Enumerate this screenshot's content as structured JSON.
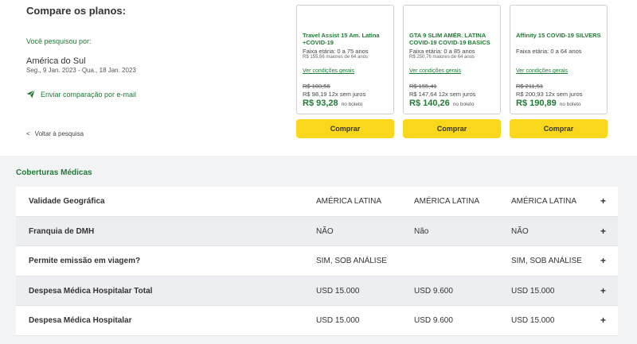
{
  "header": {
    "title": "Compare os planos:",
    "searched_label": "Você pesquisou por:",
    "destination": "América do Sul",
    "dates": "Seg., 9 Jan. 2023 - Qua., 18 Jan. 2023",
    "email_link": "Enviar comparação por e-mail",
    "back_link": "Voltar à pesquisa",
    "back_arrow": "<"
  },
  "plans": [
    {
      "name": "Travel Assist 15 Am. Latina +COVID-19",
      "age": "Faixa etária: 0 a 75 anos",
      "older": "R$ 155,66 maiores de 64 anos",
      "conditions": "Ver condições gerais",
      "old_price": "R$ 103,56",
      "installments": "R$ 98,19 12x sem juros",
      "price": "R$ 93,28",
      "boleto": "no boleto",
      "buy": "Comprar"
    },
    {
      "name": "GTA 9 SLIM AMÉR. LATINA COVID-19 COVID-19 BASICS",
      "age": "Faixa etária: 0 a 85 anos",
      "older": "R$ 250,76 maiores de 64 anos",
      "conditions": "Ver condições gerais",
      "old_price": "R$ 155,41",
      "installments": "R$ 147,64 12x sem juros",
      "price": "R$ 140,26",
      "boleto": "no boleto",
      "buy": "Comprar"
    },
    {
      "name": "Affinity 15 COVID-19 SILVERS",
      "age": "Faixa etária: 0 a 64 anos",
      "older": "",
      "conditions": "Ver condições gerais",
      "old_price": "R$ 211,51",
      "installments": "R$ 200,93 12x sem juros",
      "price": "R$ 190,89",
      "boleto": "no boleto",
      "buy": "Comprar"
    }
  ],
  "coverage": {
    "title": "Coberturas Médicas",
    "expand_icon": "+",
    "rows": [
      {
        "label": "Validade Geográfica",
        "values": [
          "AMÉRICA LATINA",
          "AMÉRICA LATINA",
          "AMÉRICA LATINA"
        ]
      },
      {
        "label": "Franquia de DMH",
        "values": [
          "NÃO",
          "Não",
          "NÃO"
        ]
      },
      {
        "label": "Permite emissão em viagem?",
        "values": [
          "SIM, SOB ANÁLISE",
          "",
          "SIM, SOB ANÁLISE"
        ]
      },
      {
        "label": "Despesa Médica Hospitalar Total",
        "values": [
          "USD 15.000",
          "USD 9.600",
          "USD 15.000"
        ]
      },
      {
        "label": "Despesa Médica Hospitalar",
        "values": [
          "USD 15.000",
          "USD 9.600",
          "USD 15.000"
        ]
      }
    ]
  },
  "colors": {
    "brand_green": "#1f7a34",
    "buy_yellow": "#f9d71c",
    "background_gray": "#f2f3f5"
  }
}
